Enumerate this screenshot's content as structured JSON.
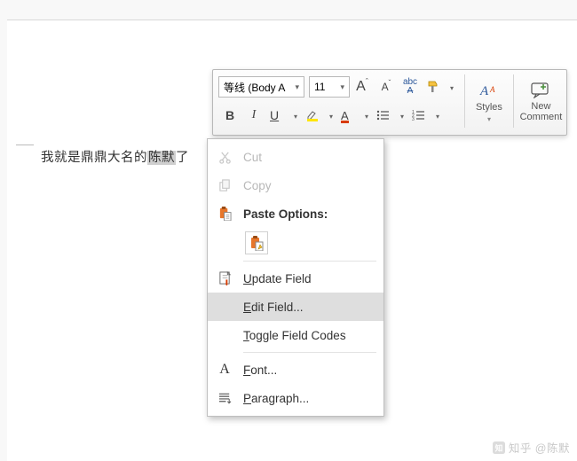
{
  "document": {
    "text_before": "我就是鼎鼎大名的",
    "text_selected": "陈默",
    "text_after": "了"
  },
  "mini_toolbar": {
    "font_name": "等线 (Body A",
    "font_size": "11",
    "grow_font_label": "A",
    "shrink_font_label": "A",
    "bold": "B",
    "italic": "I",
    "underline": "U",
    "styles_label": "Styles",
    "new_comment_line1": "New",
    "new_comment_line2": "Comment"
  },
  "context_menu": {
    "cut": "Cut",
    "copy": "Copy",
    "paste_options": "Paste Options:",
    "update_field": "pdate Field",
    "update_field_mn": "U",
    "edit_field": "dit Field...",
    "edit_field_mn": "E",
    "toggle_field": "oggle Field Codes",
    "toggle_field_mn": "T",
    "font": "ont...",
    "font_mn": "F",
    "paragraph": "aragraph...",
    "paragraph_mn": "P"
  },
  "watermark": "知乎 @陈默",
  "colors": {
    "highlight": "#ffe600",
    "font_red": "#d83b01",
    "accent_blue": "#2b579a",
    "paste_orange": "#e7762b"
  }
}
